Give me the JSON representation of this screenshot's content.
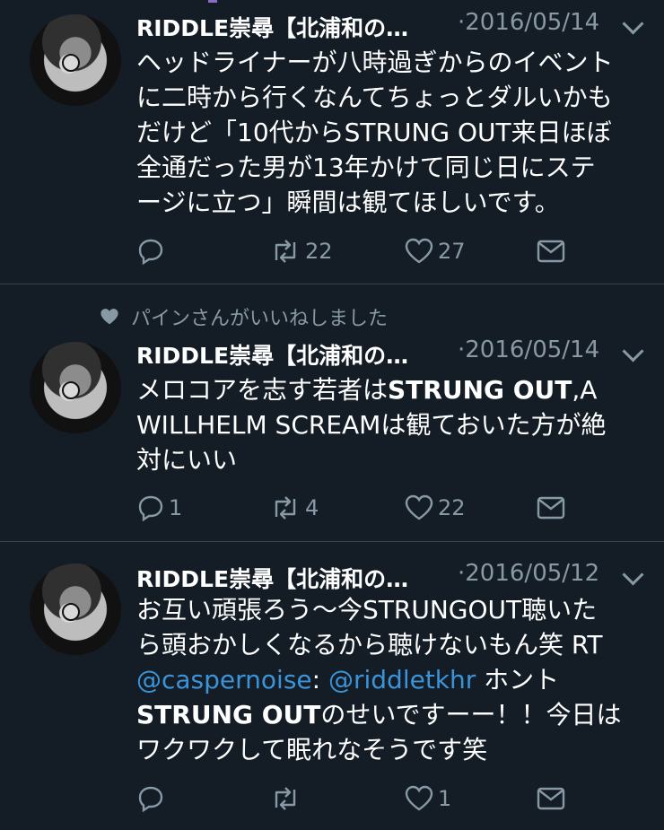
{
  "tweets": [
    {
      "author": "RIDDLE崇尋【北浦和の…",
      "date": "·2016/05/14",
      "text_plain": "ヘッドライナーが八時過ぎからのイベントに二時から行くなんてちょっとダルいかもだけど「10代からSTRUNG OUT来日ほぼ全通だった男が13年かけて同じ日にステージに立つ」瞬間は観てほしいです。",
      "lines": [
        "ヘッドライナーが八時過ぎからのイベント",
        "に二時から行くなんてちょっとダルいかも",
        "だけど「10代からSTRUNG OUT来日ほぼ",
        "全通だった男が13年かけて同じ日にステ",
        "ージに立つ」瞬間は観てほしいです。"
      ],
      "reply_count": "",
      "retweet_count": "22",
      "like_count": "27"
    },
    {
      "liked_by": "パインさんがいいねしました",
      "author": "RIDDLE崇尋【北浦和の…",
      "date": "·2016/05/14",
      "text_bold_1": "STRUNG OUT",
      "line1_pre": "メロコアを志す若者は",
      "line1_post": ",A",
      "line2": "WILLHELM SCREAMは観ておいた方が絶",
      "line3": "対にいい",
      "reply_count": "1",
      "retweet_count": "4",
      "like_count": "22"
    },
    {
      "author": "RIDDLE崇尋【北浦和の…",
      "date": "·2016/05/12",
      "line1": "お互い頑張ろう〜今STRUNGOUT聴いた",
      "line2": "ら頭おかしくなるから聴けないもん笑 RT",
      "mention1": "@caspernoise",
      "colon": ":",
      "mention2": "@riddletkhr",
      "line3_post": " ホント",
      "line4_bold": "STRUNG OUT",
      "line4_post": "のせいですーー！！今日は",
      "line5": "ワクワクして眠れなそうです笑",
      "reply_count": "",
      "retweet_count": "",
      "like_count": "1"
    }
  ],
  "colors": {
    "background": "#141d26",
    "secondary_text": "#8899a6",
    "link": "#3b94d9",
    "divider": "#38444d"
  },
  "icons": [
    "reply-icon",
    "retweet-icon",
    "like-icon",
    "dm-icon",
    "chevron-down-icon",
    "heart-icon"
  ]
}
